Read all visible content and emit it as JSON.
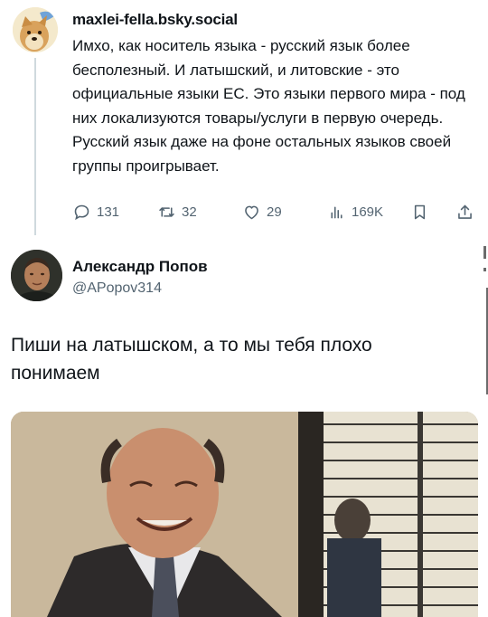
{
  "quoted_post": {
    "handle": "maxlei-fella.bsky.social",
    "text": "Имхо, как носитель языка - русский язык более бесполезный. И латышский, и литовские - это официальные языки ЕС. Это языки первого мира - под них локализуются товары/услуги в первую очередь. Русский язык даже на фоне остальных языков своей группы проигрывает.",
    "actions": {
      "replies": "131",
      "reposts": "32",
      "likes": "29",
      "views": "169K"
    }
  },
  "reply_post": {
    "name": "Александр Попов",
    "handle": "@APopov314",
    "text": "Пиши на латышском, а то мы тебя плохо понимаем"
  },
  "icons": {
    "reply": "speech-bubble-icon",
    "repost": "repost-arrows-icon",
    "like": "heart-icon",
    "views": "bar-chart-icon",
    "bookmark": "bookmark-icon",
    "share": "share-upload-icon"
  },
  "colors": {
    "text": "#0f1419",
    "secondary": "#536471",
    "divider": "#cfd9de"
  }
}
